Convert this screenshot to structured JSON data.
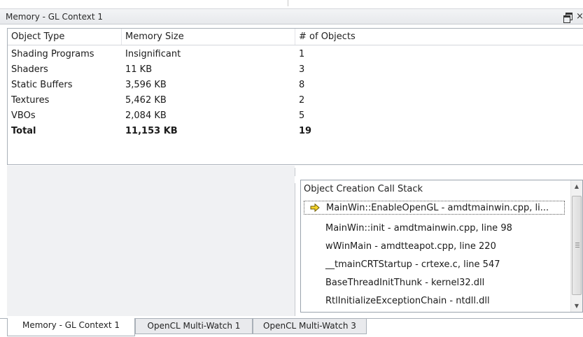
{
  "panel": {
    "title": "Memory - GL Context 1",
    "restore_icon": "restore-window-icon",
    "close_icon": "close-icon",
    "close_glyph": "×"
  },
  "memory_table": {
    "columns": [
      "Object Type",
      "Memory Size",
      "# of Objects"
    ],
    "rows": [
      {
        "type": "Shading Programs",
        "size": "Insignificant",
        "count": "1"
      },
      {
        "type": "Shaders",
        "size": "11 KB",
        "count": "3"
      },
      {
        "type": "Static Buffers",
        "size": "3,596 KB",
        "count": "8"
      },
      {
        "type": "Textures",
        "size": "5,462 KB",
        "count": "2"
      },
      {
        "type": "VBOs",
        "size": "2,084 KB",
        "count": "5"
      }
    ],
    "total": {
      "type": "Total",
      "size": "11,153 KB",
      "count": "19"
    }
  },
  "call_stack": {
    "header": "Object Creation Call Stack",
    "current_frame_icon": "current-frame-arrow-icon",
    "items": [
      "MainWin::EnableOpenGL - amdtmainwin.cpp, li...",
      "MainWin::init - amdtmainwin.cpp, line 98",
      "wWinMain - amdtteapot.cpp, line 220",
      "__tmainCRTStartup - crtexe.c, line 547",
      "BaseThreadInitThunk - kernel32.dll",
      "RtlInitializeExceptionChain - ntdll.dll"
    ],
    "selected_index": 0,
    "scroll_up_glyph": "▲",
    "scroll_down_glyph": "▼"
  },
  "tabs": [
    {
      "label": "Memory - GL Context 1",
      "active": true
    },
    {
      "label": "OpenCL Multi-Watch 1",
      "active": false
    },
    {
      "label": "OpenCL Multi-Watch 3",
      "active": false
    }
  ],
  "colors": {
    "current_frame_arrow": "#f5d32a",
    "border": "#a9b0b8",
    "empty_area": "#f0f1f3"
  }
}
